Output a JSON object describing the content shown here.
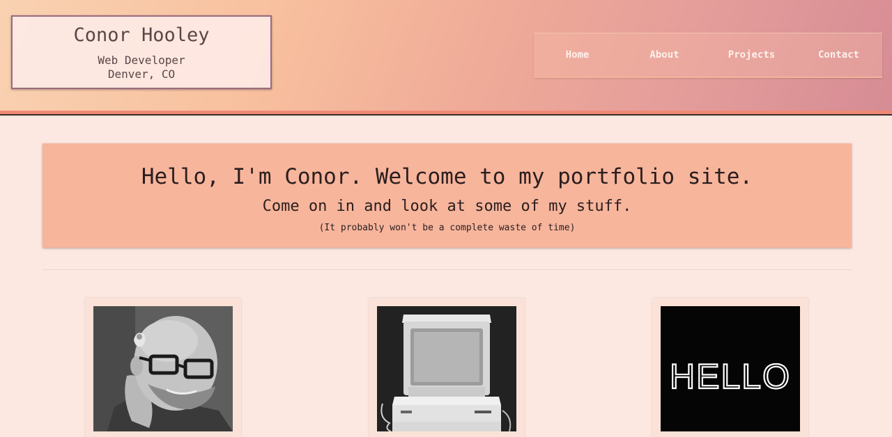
{
  "header": {
    "name": "Conor Hooley",
    "role": "Web Developer",
    "location": "Denver, CO"
  },
  "nav": {
    "items": [
      {
        "label": "Home"
      },
      {
        "label": "About"
      },
      {
        "label": "Projects"
      },
      {
        "label": "Contact"
      }
    ]
  },
  "hero": {
    "headline": "Hello, I'm Conor. Welcome to my portfolio site.",
    "subheadline": "Come on in and look at some of my stuff.",
    "note": "(It probably won't be a complete waste of time)"
  },
  "cards": [
    {
      "image": "portrait-photo"
    },
    {
      "image": "computer-photo"
    },
    {
      "image": "hello-neon-photo",
      "text": "HELLO"
    }
  ],
  "colors": {
    "page_bg": "#fce8e0",
    "hero_bg": "#f7b59c",
    "header_accent": "#f08876",
    "nav_text": "#fdf0ea"
  }
}
